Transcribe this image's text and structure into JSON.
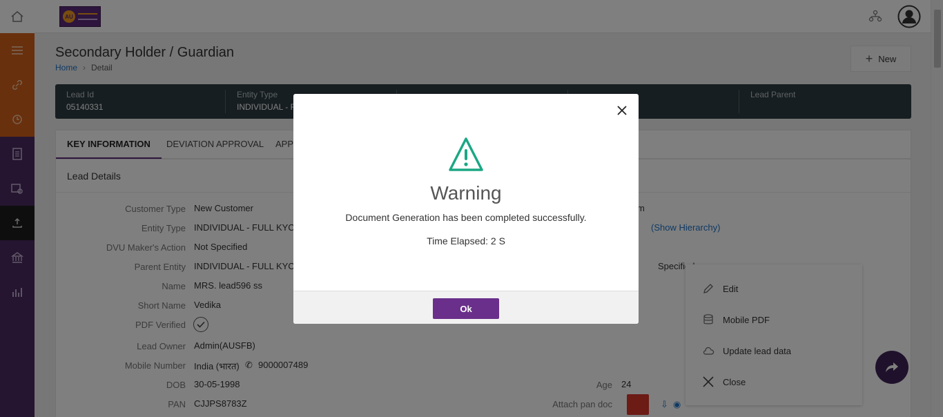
{
  "page": {
    "title": "Secondary Holder / Guardian",
    "breadcrumb": {
      "home": "Home",
      "current": "Detail"
    },
    "new_button": "New"
  },
  "info_strip": [
    {
      "label": "Lead Id",
      "value": "05140331"
    },
    {
      "label": "Entity Type",
      "value": "INDIVIDUAL - F"
    },
    {
      "label": "Lead Parent",
      "value": ""
    }
  ],
  "tabs": [
    "KEY INFORMATION",
    "DEVIATION APPROVAL",
    "APPO"
  ],
  "card": {
    "title": "Lead Details",
    "fields": [
      {
        "label": "Customer Type",
        "value": "New Customer"
      },
      {
        "label": "Entity Type",
        "value": "INDIVIDUAL - FULL KYC"
      },
      {
        "label": "DVU Maker's Action",
        "value": "Not Specified"
      },
      {
        "label": "Parent Entity",
        "value": "INDIVIDUAL - FULL KYC"
      },
      {
        "label": "Name",
        "value": "MRS. lead596 ss"
      },
      {
        "label": "Short Name",
        "value": "Vedika"
      },
      {
        "label": "PDF Verified",
        "value": ""
      },
      {
        "label": "Lead Owner",
        "value": "Admin(AUSFB)"
      },
      {
        "label": "Mobile Number",
        "value": "India (भारत)"
      },
      {
        "label": "DOB",
        "value": "30-05-1998"
      },
      {
        "label": "PAN",
        "value": "CJJPS8783Z"
      }
    ],
    "mobile_number": "9000007489",
    "right_fragment_1": "m",
    "show_hierarchy": "(Show Hierarchy)",
    "right_fragment_2": "Specified",
    "age_label": "Age",
    "age_value": "24",
    "attach_pan_label": "Attach pan doc"
  },
  "actions": [
    "Edit",
    "Mobile PDF",
    "Update lead data",
    "Close"
  ],
  "modal": {
    "title": "Warning",
    "message": "Document Generation has been completed successfully.",
    "time_elapsed": "Time Elapsed: 2 S",
    "ok_label": "Ok"
  },
  "colors": {
    "sidebar": "#4a2a60",
    "sidebar_accent": "#d3601a",
    "brand_purple": "#6a2f8a",
    "warning_green": "#1ba784",
    "info_strip": "#2e3d43"
  }
}
